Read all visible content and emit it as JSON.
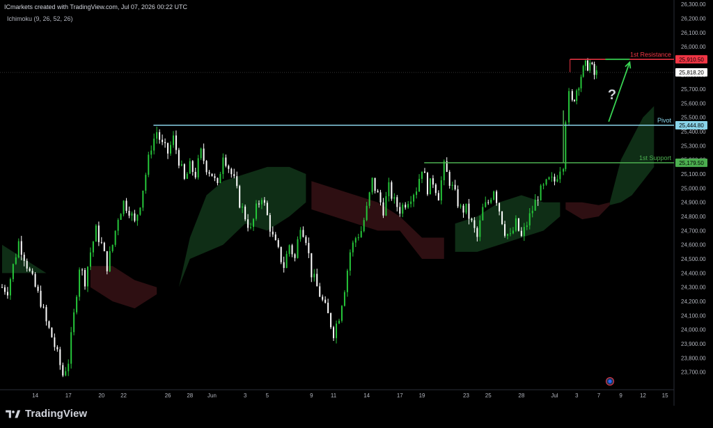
{
  "header": {
    "watermark": "ICmarkets created with TradingView.com, Jul 07, 2026 00:22 UTC",
    "indicator": "Ichimoku (9, 26, 52, 26)"
  },
  "footer": {
    "brand": "TradingView"
  },
  "chart_data": {
    "type": "candlestick",
    "indicator": "Ichimoku (9, 26, 52, 26)",
    "ylim": [
      23600,
      26330
    ],
    "y_ticks": [
      "26,300.00",
      "26,200.00",
      "26,100.00",
      "26,000.00",
      "25,900.00",
      "25,800.00",
      "25,700.00",
      "25,600.00",
      "25,500.00",
      "25,400.00",
      "25,300.00",
      "25,200.00",
      "25,100.00",
      "25,000.00",
      "24,900.00",
      "24,800.00",
      "24,700.00",
      "24,600.00",
      "24,500.00",
      "24,400.00",
      "24,300.00",
      "24,200.00",
      "24,100.00",
      "24,000.00",
      "23,900.00",
      "23,800.00",
      "23,700.00"
    ],
    "x_tick_labels": [
      {
        "label": "14",
        "x": 14
      },
      {
        "label": "17",
        "x": 17
      },
      {
        "label": "20",
        "x": 20
      },
      {
        "label": "22",
        "x": 22
      },
      {
        "label": "26",
        "x": 26
      },
      {
        "label": "28",
        "x": 28
      },
      {
        "label": "Jun",
        "x": 30
      },
      {
        "label": "3",
        "x": 33
      },
      {
        "label": "5",
        "x": 35
      },
      {
        "label": "9",
        "x": 39
      },
      {
        "label": "11",
        "x": 41
      },
      {
        "label": "14",
        "x": 44
      },
      {
        "label": "17",
        "x": 47
      },
      {
        "label": "19",
        "x": 49
      },
      {
        "label": "23",
        "x": 53
      },
      {
        "label": "25",
        "x": 55
      },
      {
        "label": "28",
        "x": 58
      },
      {
        "label": "Jul",
        "x": 61
      },
      {
        "label": "3",
        "x": 63
      },
      {
        "label": "7",
        "x": 65
      },
      {
        "label": "9",
        "x": 67
      },
      {
        "label": "12",
        "x": 69
      },
      {
        "label": "15",
        "x": 71
      }
    ],
    "levels": [
      {
        "name": "1st Resistance",
        "value": 25910.5,
        "value_label": "25,910.50",
        "color": "#f23645",
        "x_start": 62.4
      },
      {
        "name": "Pivot",
        "value": 25444.8,
        "value_label": "25,444.80",
        "color": "#89d3e8",
        "x_start": 24.7
      },
      {
        "name": "1st Support",
        "value": 25179.5,
        "value_label": "25,179.50",
        "color": "#4caf50",
        "x_start": 49.2
      }
    ],
    "last_price": {
      "value": 25818.2,
      "label": "25,818.20"
    },
    "annotation": {
      "text": "?",
      "x": 66.2,
      "y": 25630
    },
    "projection_arrow": {
      "from": {
        "x": 65.9,
        "y": 25470
      },
      "to": {
        "x": 67.8,
        "y": 25890
      }
    },
    "close_path": [
      [
        11.0,
        24300
      ],
      [
        11.5,
        24280
      ],
      [
        12.0,
        24450
      ],
      [
        12.5,
        24620
      ],
      [
        13.0,
        24520
      ],
      [
        13.5,
        24400
      ],
      [
        14.0,
        24300
      ],
      [
        14.5,
        24200
      ],
      [
        15.0,
        24050
      ],
      [
        15.5,
        23950
      ],
      [
        16.0,
        23820
      ],
      [
        16.5,
        23680
      ],
      [
        17.0,
        23780
      ],
      [
        17.5,
        24100
      ],
      [
        18.0,
        24450
      ],
      [
        18.5,
        24350
      ],
      [
        19.0,
        24550
      ],
      [
        19.5,
        24700
      ],
      [
        20.0,
        24600
      ],
      [
        20.5,
        24450
      ],
      [
        21.0,
        24600
      ],
      [
        21.5,
        24800
      ],
      [
        22.0,
        24900
      ],
      [
        22.5,
        24850
      ],
      [
        23.0,
        24750
      ],
      [
        23.5,
        24900
      ],
      [
        24.0,
        25100
      ],
      [
        24.5,
        25300
      ],
      [
        25.0,
        25400
      ],
      [
        25.5,
        25300
      ],
      [
        26.0,
        25250
      ],
      [
        26.5,
        25350
      ],
      [
        27.0,
        25200
      ],
      [
        27.5,
        25050
      ],
      [
        28.0,
        25150
      ],
      [
        28.5,
        25100
      ],
      [
        29.0,
        25250
      ],
      [
        29.5,
        25150
      ],
      [
        30.0,
        25100
      ],
      [
        30.5,
        25000
      ],
      [
        31.0,
        25250
      ],
      [
        31.5,
        25150
      ],
      [
        32.0,
        25050
      ],
      [
        32.5,
        24900
      ],
      [
        33.0,
        24800
      ],
      [
        33.5,
        24700
      ],
      [
        34.0,
        24850
      ],
      [
        34.5,
        24950
      ],
      [
        35.0,
        24800
      ],
      [
        35.5,
        24650
      ],
      [
        36.0,
        24550
      ],
      [
        36.5,
        24450
      ],
      [
        37.0,
        24600
      ],
      [
        37.5,
        24500
      ],
      [
        38.0,
        24750
      ],
      [
        38.5,
        24650
      ],
      [
        39.0,
        24400
      ],
      [
        39.5,
        24300
      ],
      [
        40.0,
        24200
      ],
      [
        40.5,
        24100
      ],
      [
        41.0,
        23980
      ],
      [
        41.5,
        24100
      ],
      [
        42.0,
        24300
      ],
      [
        42.5,
        24550
      ],
      [
        43.0,
        24650
      ],
      [
        43.5,
        24700
      ],
      [
        44.0,
        24850
      ],
      [
        44.5,
        25050
      ],
      [
        45.0,
        24950
      ],
      [
        45.5,
        24850
      ],
      [
        46.0,
        25000
      ],
      [
        46.5,
        24900
      ],
      [
        47.0,
        24850
      ],
      [
        47.5,
        24900
      ],
      [
        48.0,
        24950
      ],
      [
        48.5,
        25000
      ],
      [
        49.0,
        25150
      ],
      [
        49.5,
        25000
      ],
      [
        50.0,
        25050
      ],
      [
        50.5,
        24950
      ],
      [
        51.0,
        25150
      ],
      [
        51.5,
        25050
      ],
      [
        52.0,
        24950
      ],
      [
        52.5,
        24850
      ],
      [
        53.0,
        24850
      ],
      [
        53.5,
        24750
      ],
      [
        54.0,
        24650
      ],
      [
        54.5,
        24850
      ],
      [
        55.0,
        24900
      ],
      [
        55.5,
        25000
      ],
      [
        56.0,
        24850
      ],
      [
        56.5,
        24700
      ],
      [
        57.0,
        24650
      ],
      [
        57.5,
        24750
      ],
      [
        58.0,
        24650
      ],
      [
        58.5,
        24750
      ],
      [
        59.0,
        24850
      ],
      [
        59.5,
        24950
      ],
      [
        60.0,
        25000
      ],
      [
        60.5,
        25050
      ],
      [
        61.0,
        25050
      ],
      [
        61.5,
        25150
      ],
      [
        61.8,
        25180
      ],
      [
        62.0,
        25500
      ],
      [
        62.3,
        25650
      ],
      [
        62.6,
        25600
      ],
      [
        63.0,
        25700
      ],
      [
        63.4,
        25800
      ],
      [
        63.8,
        25860
      ],
      [
        64.2,
        25880
      ],
      [
        64.6,
        25800
      ],
      [
        65.0,
        25820
      ]
    ],
    "cloud_green": [
      [
        11.0,
        24600,
        24400
      ],
      [
        13.0,
        24500,
        24400
      ],
      [
        15.0,
        24400,
        24400
      ],
      [
        27.0,
        24300,
        24300
      ],
      [
        28.0,
        24650,
        24500
      ],
      [
        29.5,
        24950,
        24550
      ],
      [
        31.0,
        25050,
        24600
      ],
      [
        33.0,
        25100,
        24750
      ],
      [
        35.0,
        25150,
        24700
      ],
      [
        37.0,
        25150,
        24800
      ],
      [
        38.5,
        25100,
        24900
      ],
      [
        52.0,
        24750,
        24550
      ],
      [
        54.0,
        24800,
        24550
      ],
      [
        56.0,
        24900,
        24600
      ],
      [
        58.0,
        24950,
        24650
      ],
      [
        60.0,
        24900,
        24700
      ],
      [
        61.5,
        24900,
        24800
      ],
      [
        66.0,
        24900,
        24880
      ],
      [
        67.0,
        25200,
        24900
      ],
      [
        68.0,
        25350,
        24950
      ],
      [
        69.0,
        25500,
        25050
      ],
      [
        70.0,
        25580,
        25150
      ]
    ],
    "cloud_red": [
      [
        19.0,
        24300,
        24450
      ],
      [
        21.0,
        24200,
        24450
      ],
      [
        23.0,
        24150,
        24350
      ],
      [
        25.0,
        24250,
        24300
      ],
      [
        39.0,
        24850,
        25050
      ],
      [
        41.0,
        24800,
        25000
      ],
      [
        43.0,
        24750,
        24950
      ],
      [
        45.0,
        24700,
        24900
      ],
      [
        47.0,
        24700,
        24800
      ],
      [
        49.0,
        24500,
        24650
      ],
      [
        51.0,
        24500,
        24650
      ],
      [
        62.0,
        24850,
        24900
      ],
      [
        63.5,
        24780,
        24900
      ],
      [
        65.0,
        24800,
        24880
      ],
      [
        66.0,
        24880,
        24900
      ]
    ]
  }
}
